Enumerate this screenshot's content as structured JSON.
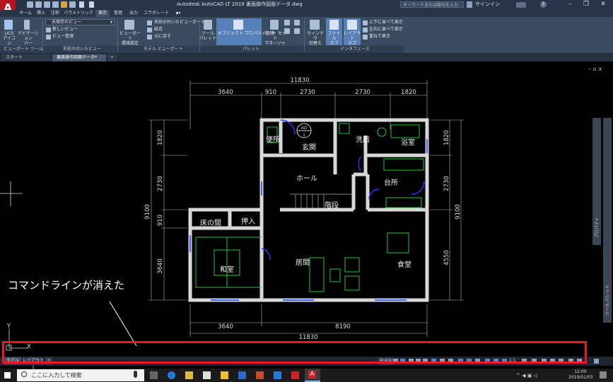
{
  "app": {
    "title": "Autodesk AutoCAD LT 2019   裏面操作図面データ.dwg",
    "search_placeholder": "キーワードまたは語句を入力",
    "signin": "サインイン",
    "logo_letter": "A"
  },
  "ribbon_tabs": [
    "ホーム",
    "挿入",
    "注釈",
    "パラメトリック",
    "表示",
    "管理",
    "出力",
    "コラボレート"
  ],
  "ribbon": {
    "ucs_label": "UCS\nアイコン",
    "navbar_label": "ナビゲーション\nバー",
    "saved_view": "未保存のビュー",
    "new_view": "新しいビュー",
    "view_manager": "ビュー管理",
    "viewport_config": "ビューポート\n環境設定",
    "named_viewports": "名前の付いたビューポート",
    "join": "結合",
    "restore": "元に戻す",
    "tool_palette": "ツール\nパレット",
    "properties": "オブジェクト プロパティ管理",
    "sheet_set": "シート セット\nマネージャ",
    "switch_window": "ウィンドウ\n切替え",
    "file_tabs": "ファイル\nタブ",
    "layout_tabs": "レイアウト\nタブ",
    "tile_h": "上下に並べて表示",
    "tile_v": "左右に並べて表示",
    "cascade": "重ねて表示",
    "panels": [
      "ビューポート ツール",
      "名前の付いたビュー",
      "モデル ビューポート",
      "パレット",
      "インタフェース"
    ]
  },
  "file_tabs": [
    "スタート",
    "裏面操作図面データ*"
  ],
  "plan": {
    "dims_top": [
      "11830",
      "3640",
      "910",
      "2730",
      "2730",
      "1820"
    ],
    "dims_bottom": [
      "3640",
      "8190",
      "11830"
    ],
    "dims_left": [
      "1820",
      "2730",
      "9100",
      "910",
      "3640"
    ],
    "dims_right": [
      "1820",
      "2730",
      "9100",
      "4550"
    ],
    "rooms": {
      "toilet": "便所",
      "entrance": "玄関",
      "washroom": "洗面",
      "bathroom": "浴室",
      "hall": "ホール",
      "kitchen": "台所",
      "stairs": "階段",
      "tokonoma": "床の間",
      "closet": "押入",
      "japanese_room": "和室",
      "living": "居間",
      "dining": "食堂"
    },
    "marker_top": "AD",
    "marker_bottom": "1"
  },
  "annotation": "コマンドラインが消えた",
  "right_panel": {
    "label1": "プロパティ",
    "label2": "ツール パレット"
  },
  "layout_tabs": [
    "モデル",
    "レイアウト1"
  ],
  "status": {
    "model": "モデル",
    "scale": "1:1"
  },
  "taskbar": {
    "search": "ここに入力して検索",
    "time": "12:00",
    "date": "2019/01/03"
  },
  "colors": {
    "accent_red": "#e41c1c",
    "wall": "#d8d8d8",
    "door_blue": "#1f3cff",
    "furniture_green": "#25c83a"
  }
}
